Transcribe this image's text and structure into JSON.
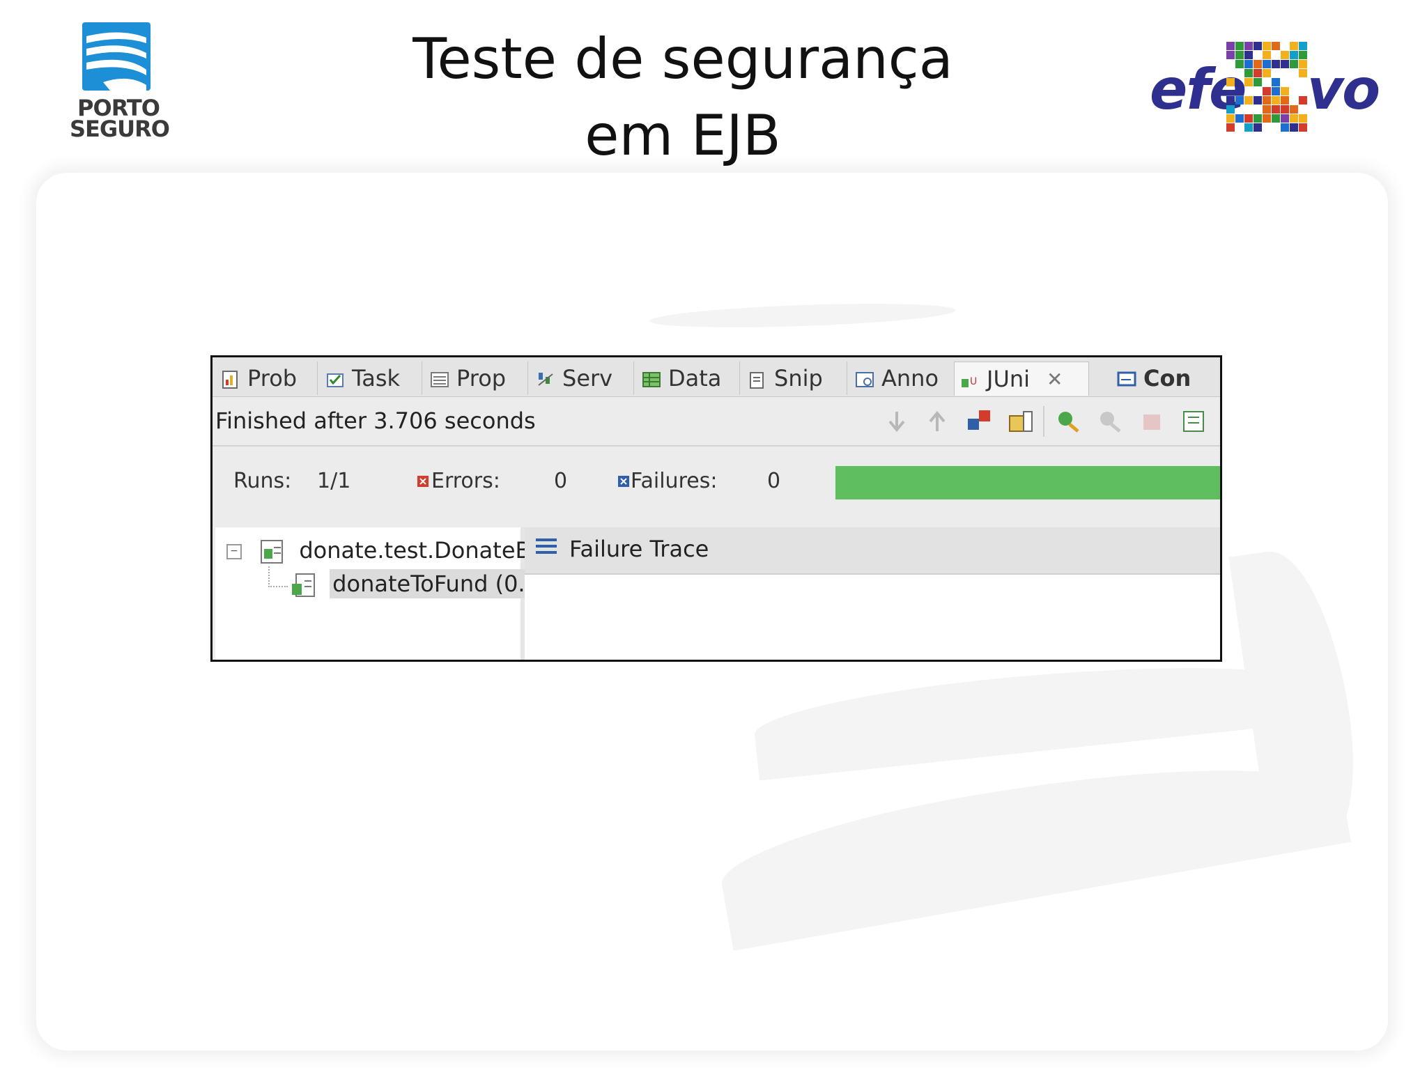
{
  "header": {
    "title_line1": "Teste de segurança",
    "title_line2": "em EJB",
    "logo_left": {
      "line1": "PORTO",
      "line2": "SEGURO"
    },
    "logo_right": {
      "left": "efe",
      "right": "vo"
    }
  },
  "junit": {
    "tabs": [
      {
        "label": "Prob",
        "icon": "problems-icon"
      },
      {
        "label": "Task",
        "icon": "tasks-icon"
      },
      {
        "label": "Prop",
        "icon": "properties-icon"
      },
      {
        "label": "Serv",
        "icon": "servers-icon"
      },
      {
        "label": "Data",
        "icon": "data-source-icon"
      },
      {
        "label": "Snip",
        "icon": "snippets-icon"
      },
      {
        "label": "Anno",
        "icon": "annotations-icon"
      },
      {
        "label": "JUni",
        "icon": "junit-icon",
        "active": true
      },
      {
        "label": "Con",
        "icon": "console-icon"
      }
    ],
    "status": "Finished after 3.706 seconds",
    "runs_label": "Runs:",
    "runs_value": "1/1",
    "errors_label": "Errors:",
    "errors_value": "0",
    "failures_label": "Failures:",
    "failures_value": "0",
    "progress": 1.0,
    "progress_color": "#5fbf5f",
    "tree": {
      "suite": "donate.test.DonateBe",
      "test": "donateToFund (0."
    },
    "failure_trace_label": "Failure Trace"
  }
}
